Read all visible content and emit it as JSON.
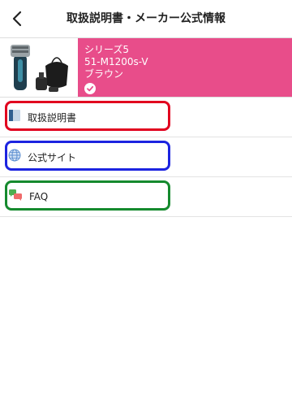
{
  "header": {
    "title": "取扱説明書・メーカー公式情報"
  },
  "product": {
    "series": "シリーズ5",
    "model": "51-M1200s-V",
    "brand": "ブラウン",
    "card_color": "#e84d8a"
  },
  "menu": {
    "items": [
      {
        "label": "取扱説明書",
        "icon": "manual-book-icon",
        "highlight": "#e1001f"
      },
      {
        "label": "公式サイト",
        "icon": "globe-icon",
        "highlight": "#1c24e0"
      },
      {
        "label": "FAQ",
        "icon": "faq-chat-icon",
        "highlight": "#158a2e"
      }
    ]
  }
}
